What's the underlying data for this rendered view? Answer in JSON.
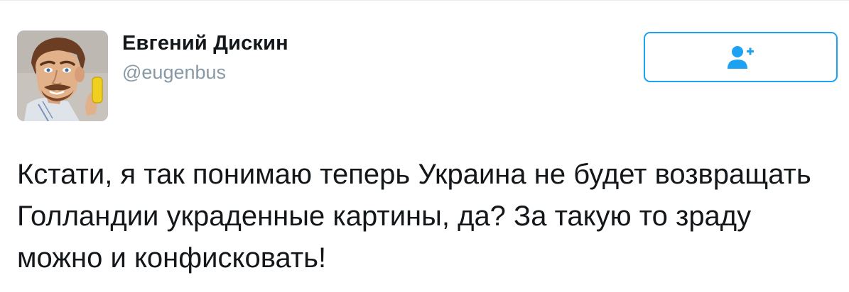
{
  "user": {
    "name": "Евгений Дискин",
    "handle": "@eugenbus"
  },
  "follow_button": {
    "icon": "follow-user-plus-icon",
    "color": "#1da1f2"
  },
  "tweet": {
    "text": "Кстати, я так понимаю теперь Украина не будет возвращать Голландии украденные картины, да? За такую то зраду можно и конфисковать!"
  },
  "colors": {
    "text": "#14171a",
    "secondary": "#8899a6",
    "accent": "#1da1f2"
  }
}
